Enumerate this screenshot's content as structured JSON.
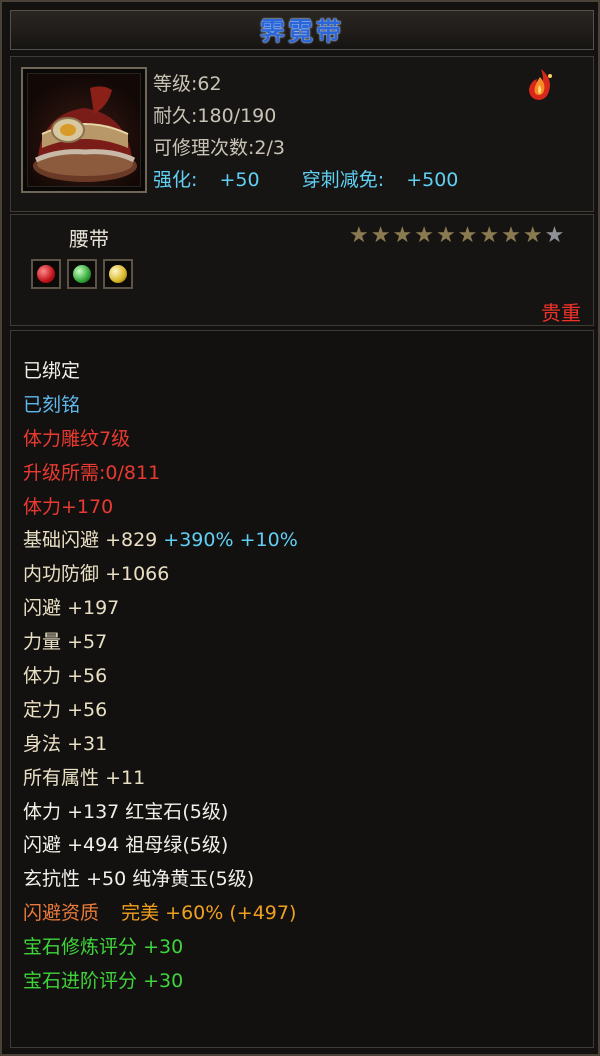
{
  "title": "霁霓带",
  "header": {
    "level_label": "等级",
    "level_value": ":62",
    "durability_label": "耐久",
    "durability_value": ":180/190",
    "repair_label": "可修理次数",
    "repair_value": ":2/3",
    "enhance_label": "强化:",
    "enhance_value": "+50",
    "pierce_label": "穿刺减免:",
    "pierce_value": "+500"
  },
  "item_type": "腰带",
  "stars": {
    "filled": 9,
    "total": 10
  },
  "gems": [
    "red",
    "green",
    "yellow"
  ],
  "rarity": "贵重",
  "colors": {
    "title": "#2b67d8",
    "cyan": "#5fd0f4",
    "red": "#e83a30",
    "green": "#3ed43a",
    "orange": "#e87a3a"
  },
  "attributes": {
    "bound": "已绑定",
    "engraved": "已刻铭",
    "pattern": "体力雕纹7级",
    "upgrade": "升级所需:0/811",
    "stamina_bonus": "体力+170",
    "base_dodge_label": "基础闪避",
    "base_dodge_value": "+829",
    "base_dodge_pct1": "+390%",
    "base_dodge_pct2": "+10%",
    "inner_def_label": "内功防御",
    "inner_def_value": "+1066",
    "dodge_label": "闪避",
    "dodge_value": "+197",
    "strength_label": "力量",
    "strength_value": "+57",
    "stamina_label": "体力",
    "stamina_value": "+56",
    "focus_label": "定力",
    "focus_value": "+56",
    "agility_label": "身法",
    "agility_value": "+31",
    "all_attr_label": "所有属性",
    "all_attr_value": "+11",
    "gem1_stat": "体力",
    "gem1_value": "+137",
    "gem1_name": "红宝石",
    "gem1_level": "(5级)",
    "gem2_stat": "闪避",
    "gem2_value": "+494",
    "gem2_name": "祖母绿",
    "gem2_level": "(5级)",
    "gem3_stat": "玄抗性",
    "gem3_value": "+50",
    "gem3_name": "纯净黄玉",
    "gem3_level": "(5级)",
    "quality_label": "闪避资质",
    "quality_grade": "完美",
    "quality_pct": "+60%",
    "quality_bonus": "(+497)",
    "gem_refine_label": "宝石修炼评分",
    "gem_refine_value": "+30",
    "gem_advance_label": "宝石进阶评分",
    "gem_advance_value": "+30"
  }
}
